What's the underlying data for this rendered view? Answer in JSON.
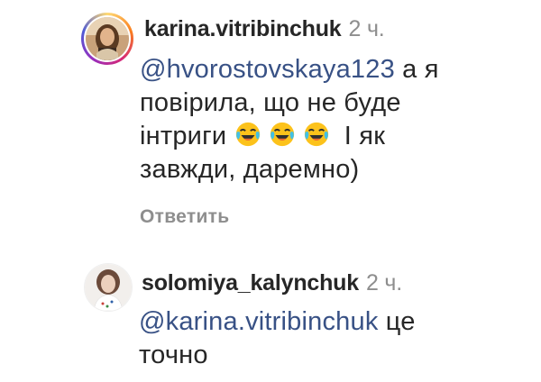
{
  "comments": [
    {
      "username": "karina.vitribinchuk",
      "time": "2 ч.",
      "mention": "@hvorostovskaya123",
      "text_part1": " а я",
      "text_line2": "повірила, що не буде",
      "text_line3_a": "інтриги ",
      "emojis": [
        "face-with-tears-of-joy-icon",
        "face-with-tears-of-joy-icon",
        "face-with-tears-of-joy-icon"
      ],
      "text_line3_b": " І як",
      "text_line4": "завжди,  даремно)",
      "reply_label": "Ответить",
      "has_story_ring": true
    },
    {
      "username": "solomiya_kalynchuk",
      "time": "2 ч.",
      "mention": "@karina.vitribinchuk",
      "text_part1": " це",
      "text_line2": "точно",
      "has_story_ring": false
    }
  ],
  "colors": {
    "mention": "#385185",
    "muted": "#8e8e8e",
    "text": "#262626"
  }
}
